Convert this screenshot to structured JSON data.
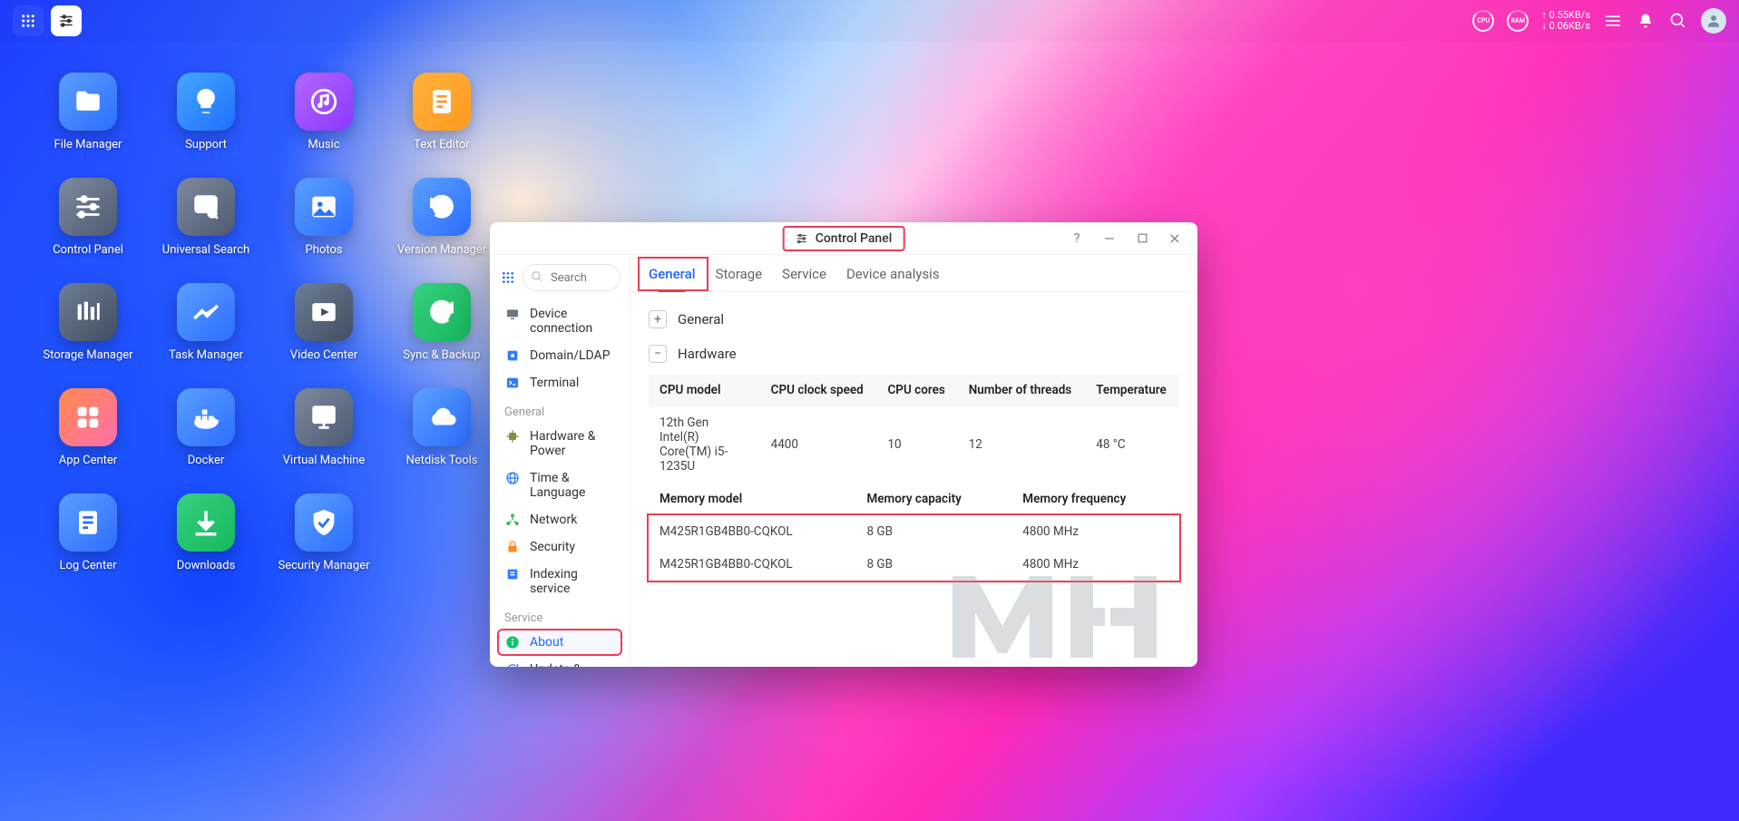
{
  "topbar": {
    "cpu_gauge_label": "CPU",
    "ram_gauge_label": "RAM",
    "net_up": "↑ 0.55KB/s",
    "net_down": "↓ 0.06KB/s"
  },
  "desktop_apps": [
    {
      "label": "File Manager",
      "bg": "linear-gradient(135deg,#5aa0ff,#2d6dff)",
      "glyph": "folder"
    },
    {
      "label": "Support",
      "bg": "linear-gradient(135deg,#45a8ff,#1f6fff)",
      "glyph": "bulb"
    },
    {
      "label": "Music",
      "bg": "linear-gradient(135deg,#b467ff,#8a38ff)",
      "glyph": "music"
    },
    {
      "label": "Text Editor",
      "bg": "linear-gradient(135deg,#ffb13d,#ff9b1f)",
      "glyph": "text"
    },
    {
      "label": "Control Panel",
      "bg": "linear-gradient(135deg,#7d8aa0,#4e5a70)",
      "glyph": "sliders"
    },
    {
      "label": "Universal Search",
      "bg": "linear-gradient(135deg,#7d8aa0,#4e5a70)",
      "glyph": "searchlist"
    },
    {
      "label": "Photos",
      "bg": "linear-gradient(135deg,#5aa0ff,#2d6dff)",
      "glyph": "image"
    },
    {
      "label": "Version Manager",
      "bg": "linear-gradient(135deg,#5aa0ff,#2d6dff)",
      "glyph": "restore"
    },
    {
      "label": "Storage Manager",
      "bg": "linear-gradient(135deg,#6f7e95,#414d61)",
      "glyph": "bars"
    },
    {
      "label": "Task Manager",
      "bg": "linear-gradient(135deg,#5aa0ff,#2d6dff)",
      "glyph": "chart"
    },
    {
      "label": "Video Center",
      "bg": "linear-gradient(135deg,#6f7e95,#414d61)",
      "glyph": "video"
    },
    {
      "label": "Sync & Backup",
      "bg": "linear-gradient(135deg,#35d07f,#17b85e)",
      "glyph": "sync"
    },
    {
      "label": "App Center",
      "bg": "linear-gradient(135deg,#ff8a4a,#ff6fb0)",
      "glyph": "apps"
    },
    {
      "label": "Docker",
      "bg": "linear-gradient(135deg,#5aa0ff,#2d6dff)",
      "glyph": "docker"
    },
    {
      "label": "Virtual Machine",
      "bg": "linear-gradient(135deg,#7d8aa0,#4e5a70)",
      "glyph": "vm"
    },
    {
      "label": "Netdisk Tools",
      "bg": "linear-gradient(135deg,#5aa0ff,#2d6dff)",
      "glyph": "cloud"
    },
    {
      "label": "Log Center",
      "bg": "linear-gradient(135deg,#5aa0ff,#2d6dff)",
      "glyph": "log"
    },
    {
      "label": "Downloads",
      "bg": "linear-gradient(135deg,#35d07f,#17b85e)",
      "glyph": "download"
    },
    {
      "label": "Security Manager",
      "bg": "linear-gradient(135deg,#5aa0ff,#2d6dff)",
      "glyph": "shield"
    }
  ],
  "window": {
    "title": "Control Panel",
    "search_placeholder": "Search",
    "sidebar": {
      "top_items": [
        {
          "label": "Device connection",
          "icon": "device",
          "color": "#6b7684"
        },
        {
          "label": "Domain/LDAP",
          "icon": "domain",
          "color": "#2f7dff"
        },
        {
          "label": "Terminal",
          "icon": "terminal",
          "color": "#2f7dff"
        }
      ],
      "groups": [
        {
          "title": "General",
          "items": [
            {
              "label": "Hardware & Power",
              "icon": "chip",
              "color": "#8c8c46"
            },
            {
              "label": "Time & Language",
              "icon": "globe",
              "color": "#2f7dff"
            },
            {
              "label": "Network",
              "icon": "network",
              "color": "#38b55c"
            },
            {
              "label": "Security",
              "icon": "lock",
              "color": "#ff8a2a"
            },
            {
              "label": "Indexing service",
              "icon": "index",
              "color": "#2f7dff"
            }
          ]
        },
        {
          "title": "Service",
          "items": [
            {
              "label": "About",
              "icon": "info",
              "color": "#13c26b",
              "active": true
            },
            {
              "label": "Update & Restore",
              "icon": "update",
              "color": "#2f7dff"
            }
          ]
        }
      ]
    },
    "tabs": [
      "General",
      "Storage",
      "Service",
      "Device analysis"
    ],
    "active_tab": "General",
    "sections": {
      "general_label": "General",
      "hardware_label": "Hardware"
    },
    "cpu_table": {
      "headers": [
        "CPU model",
        "CPU clock speed",
        "CPU cores",
        "Number of threads",
        "Temperature"
      ],
      "row": [
        "12th Gen Intel(R) Core(TM) i5-1235U",
        "4400",
        "10",
        "12",
        "48 °C"
      ]
    },
    "mem_table": {
      "headers": [
        "Memory model",
        "Memory capacity",
        "Memory frequency"
      ],
      "rows": [
        [
          "M425R1GB4BB0-CQKOL",
          "8 GB",
          "4800 MHz"
        ],
        [
          "M425R1GB4BB0-CQKOL",
          "8 GB",
          "4800 MHz"
        ]
      ]
    },
    "watermark": "MH"
  }
}
